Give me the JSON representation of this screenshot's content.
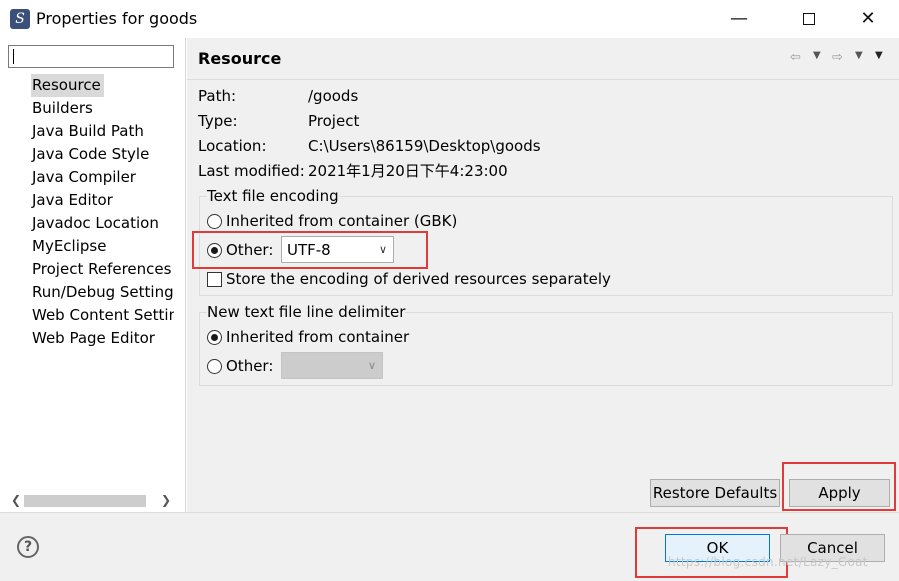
{
  "window": {
    "title": "Properties for goods",
    "icon": "eclipse-s-icon",
    "controls": [
      "minimize",
      "maximize",
      "close"
    ]
  },
  "filter": {
    "value": "",
    "placeholder": ""
  },
  "nav": {
    "items": [
      {
        "label": "Resource",
        "selected": true
      },
      {
        "label": "Builders"
      },
      {
        "label": "Java Build Path"
      },
      {
        "label": "Java Code Style"
      },
      {
        "label": "Java Compiler"
      },
      {
        "label": "Java Editor"
      },
      {
        "label": "Javadoc Location"
      },
      {
        "label": "MyEclipse"
      },
      {
        "label": "Project References"
      },
      {
        "label": "Run/Debug Settings"
      },
      {
        "label": "Web Content Settings"
      },
      {
        "label": "Web Page Editor"
      }
    ]
  },
  "page": {
    "title": "Resource",
    "info": [
      {
        "label": "Path:",
        "value": "/goods"
      },
      {
        "label": "Type:",
        "value": "Project"
      },
      {
        "label": "Location:",
        "value": "C:\\Users\\86159\\Desktop\\goods"
      },
      {
        "label": "Last modified:",
        "value": "2021年1月20日下午4:23:00"
      }
    ],
    "encoding": {
      "title": "Text file encoding",
      "inherited_label": "Inherited from container (GBK)",
      "other_label": "Other:",
      "other_value": "UTF-8",
      "selected": "other",
      "store_label": "Store the encoding of derived resources separately",
      "store_checked": false
    },
    "delimiter": {
      "title": "New text file line delimiter",
      "inherited_label": "Inherited from container",
      "other_label": "Other:",
      "other_value": "",
      "selected": "inherited"
    },
    "restore_label": "Restore Defaults",
    "apply_label": "Apply"
  },
  "footer": {
    "ok_label": "OK",
    "cancel_label": "Cancel"
  },
  "watermark": "https://blog.csdn.net/Lazy_Goat",
  "colors": {
    "highlight": "#e03b3b",
    "pane_bg": "#f0f0f0",
    "selection": "#d9d9d9"
  }
}
